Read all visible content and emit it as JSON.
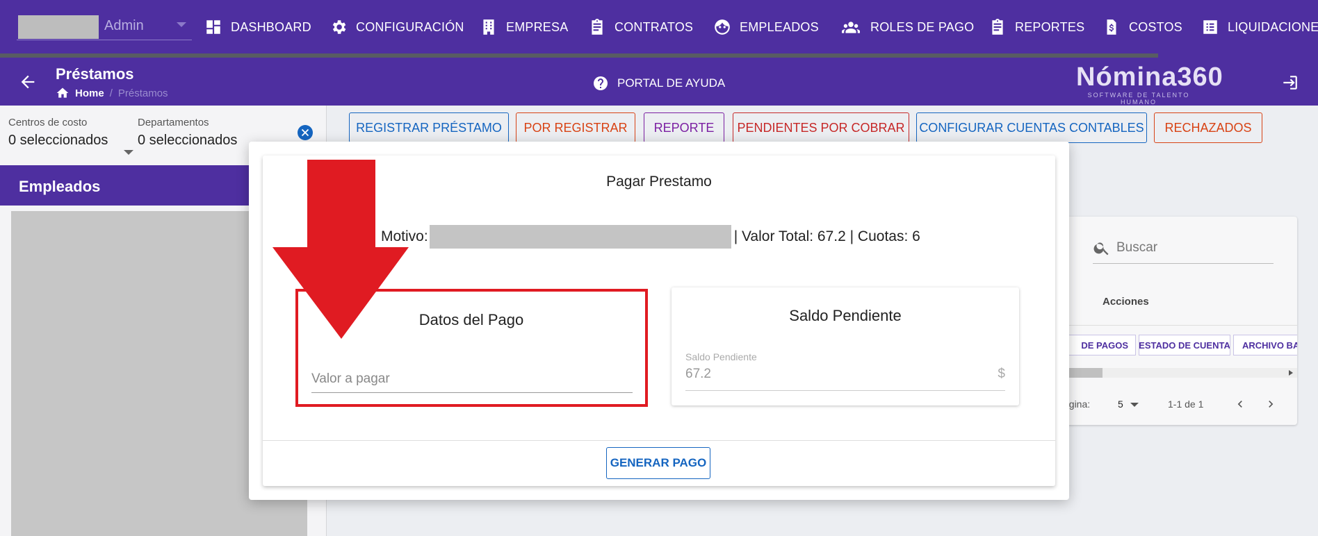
{
  "topnav": {
    "user_name": "Admin",
    "items": [
      {
        "label": "DASHBOARD",
        "icon": "dashboard-icon"
      },
      {
        "label": "CONFIGURACIÓN",
        "icon": "gear-icon"
      },
      {
        "label": "EMPRESA",
        "icon": "building-icon"
      },
      {
        "label": "CONTRATOS",
        "icon": "clipboard-icon"
      },
      {
        "label": "EMPLEADOS",
        "icon": "face-icon"
      },
      {
        "label": "ROLES DE PAGO",
        "icon": "people-icon"
      },
      {
        "label": "REPORTES",
        "icon": "clipboard-icon"
      },
      {
        "label": "COSTOS",
        "icon": "invoice-icon"
      },
      {
        "label": "LIQUIDACIONE",
        "icon": "list-icon"
      }
    ]
  },
  "subheader": {
    "title": "Préstamos",
    "breadcrumb_home": "Home",
    "breadcrumb_sep": "/",
    "breadcrumb_current": "Préstamos",
    "help_label": "PORTAL DE AYUDA",
    "brand_name": "Nómina360",
    "brand_tagline": "SOFTWARE DE TALENTO HUMANO"
  },
  "filters": {
    "cost_center_label": "Centros de costo",
    "cost_center_value": "0 seleccionados",
    "department_label": "Departamentos",
    "department_value": "0 seleccionados"
  },
  "employees": {
    "header": "Empleados"
  },
  "actions": [
    {
      "label": "REGISTRAR PRÉSTAMO",
      "color": "#1565c0"
    },
    {
      "label": "POR REGISTRAR",
      "color": "#d84315"
    },
    {
      "label": "REPORTE",
      "color": "#7b1fa2"
    },
    {
      "label": "PENDIENTES POR COBRAR",
      "color": "#c62828"
    },
    {
      "label": "CONFIGURAR CUENTAS CONTABLES",
      "color": "#1565c0"
    },
    {
      "label": "RECHAZADOS",
      "color": "#d84315"
    }
  ],
  "table": {
    "search_placeholder": "Buscar",
    "col_acciones": "Acciones",
    "row_buttons": [
      "DE PAGOS",
      "ESTADO DE CUENTA",
      "ARCHIVO BA"
    ],
    "rows_per_page_label": "ágina:",
    "rows_per_page_value": "5",
    "range": "1-1 de 1"
  },
  "modal": {
    "title": "Pagar Prestamo",
    "motivo_label": "Motivo:",
    "summary": "| Valor Total: 67.2 | Cuotas: 6",
    "pay_card_title": "Datos del Pago",
    "pay_input_placeholder": "Valor a pagar",
    "saldo_card_title": "Saldo Pendiente",
    "saldo_label": "Saldo Pendiente",
    "saldo_value": "67.2",
    "saldo_suffix": "$",
    "generate_button": "GENERAR PAGO"
  },
  "colors": {
    "primary": "#4e2fa0",
    "annotation_red": "#e01b22",
    "accent_blue": "#1565c0"
  }
}
